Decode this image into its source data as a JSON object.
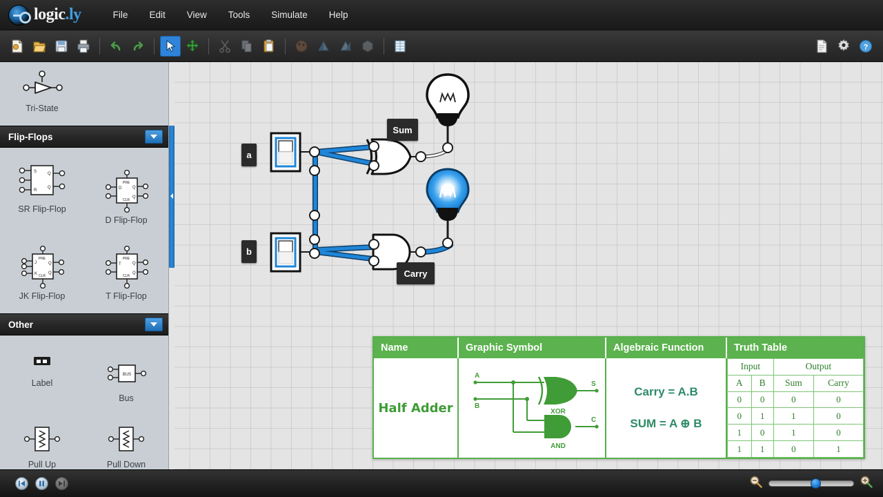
{
  "app": {
    "brand_name": "logic",
    "brand_suffix": ".ly",
    "brand_dot": "."
  },
  "menu": {
    "items": [
      {
        "label": "File",
        "name": "menu-file"
      },
      {
        "label": "Edit",
        "name": "menu-edit"
      },
      {
        "label": "View",
        "name": "menu-view"
      },
      {
        "label": "Tools",
        "name": "menu-tools"
      },
      {
        "label": "Simulate",
        "name": "menu-simulate"
      },
      {
        "label": "Help",
        "name": "menu-help"
      }
    ]
  },
  "toolbar": {
    "items": [
      {
        "icon": "new-document-icon",
        "label": "New"
      },
      {
        "icon": "open-folder-icon",
        "label": "Open"
      },
      {
        "icon": "save-disk-icon",
        "label": "Save"
      },
      {
        "icon": "print-icon",
        "label": "Print"
      },
      {
        "icon": "undo-arrow-icon",
        "label": "Undo"
      },
      {
        "icon": "redo-arrow-icon",
        "label": "Redo"
      },
      {
        "icon": "select-cursor-icon",
        "label": "Select"
      },
      {
        "icon": "move-pan-icon",
        "label": "Move"
      },
      {
        "icon": "cut-scissors-icon",
        "label": "Cut"
      },
      {
        "icon": "copy-icon",
        "label": "Copy"
      },
      {
        "icon": "paste-clipboard-icon",
        "label": "Paste"
      },
      {
        "icon": "color-palette-icon",
        "label": "Color"
      },
      {
        "icon": "bring-forward-icon",
        "label": "Bring Forward"
      },
      {
        "icon": "send-backward-icon",
        "label": "Send Backward"
      },
      {
        "icon": "group-icon",
        "label": "Group"
      },
      {
        "icon": "truth-table-icon",
        "label": "Truth Table"
      }
    ],
    "active_tool": "select-cursor-icon",
    "right_items": [
      {
        "icon": "properties-icon",
        "label": "Properties"
      },
      {
        "icon": "gear-icon",
        "label": "Settings"
      },
      {
        "icon": "help-icon",
        "label": "Help"
      }
    ]
  },
  "sidebar": {
    "top_section": {
      "items": [
        {
          "label": "Tri-State",
          "icon": "tri-state-buffer-icon"
        }
      ]
    },
    "sections": [
      {
        "title": "Flip-Flops",
        "name": "section-flip-flops",
        "items": [
          {
            "label": "SR Flip-Flop",
            "icon": "sr-flip-flop-icon"
          },
          {
            "label": "D Flip-Flop",
            "icon": "d-flip-flop-icon"
          },
          {
            "label": "JK Flip-Flop",
            "icon": "jk-flip-flop-icon"
          },
          {
            "label": "T Flip-Flop",
            "icon": "t-flip-flop-icon"
          }
        ]
      },
      {
        "title": "Other",
        "name": "section-other",
        "items": [
          {
            "label": "Label",
            "icon": "label-icon"
          },
          {
            "label": "Bus",
            "icon": "bus-icon"
          },
          {
            "label": "Pull Up",
            "icon": "pull-up-resistor-icon"
          },
          {
            "label": "Pull Down",
            "icon": "pull-down-resistor-icon"
          }
        ]
      }
    ]
  },
  "canvas": {
    "labels": {
      "input_a": "a",
      "input_b": "b",
      "output_sum": "Sum",
      "output_carry": "Carry"
    },
    "components": {
      "switch_a_state": "on",
      "switch_b_state": "on",
      "xor_gate": "XOR",
      "and_gate": "AND",
      "sum_bulb_state": "off",
      "carry_bulb_state": "on"
    },
    "colors": {
      "wire_high": "#1f7fd0",
      "wire_low": "#ffffff",
      "grid": "#e4e4e4",
      "bulb_lit": "#2196f3"
    }
  },
  "reference_card": {
    "headers": [
      "Name",
      "Graphic Symbol",
      "Algebraic Function",
      "Truth Table"
    ],
    "name": "Half Adder",
    "symbol": {
      "inputs": [
        "A",
        "B"
      ],
      "outputs": [
        "S",
        "C"
      ],
      "gates": [
        "XOR",
        "AND"
      ]
    },
    "algebraic": [
      "Carry = A.B",
      "SUM = A ⊕ B"
    ],
    "truth_table": {
      "group_headers": [
        "Input",
        "Output"
      ],
      "columns": [
        "A",
        "B",
        "Sum",
        "Carry"
      ],
      "rows": [
        [
          "0",
          "0",
          "0",
          "0"
        ],
        [
          "0",
          "1",
          "1",
          "0"
        ],
        [
          "1",
          "0",
          "1",
          "0"
        ],
        [
          "1",
          "1",
          "0",
          "1"
        ]
      ]
    },
    "accent_color": "#5cb24e"
  },
  "statusbar": {
    "sim_buttons": [
      {
        "icon": "restart-simulation-icon",
        "label": "Restart",
        "enabled": true
      },
      {
        "icon": "pause-simulation-icon",
        "label": "Pause",
        "enabled": true
      },
      {
        "icon": "step-simulation-icon",
        "label": "Step",
        "enabled": false
      }
    ],
    "zoom": {
      "out_icon": "zoom-out-icon",
      "in_icon": "zoom-in-icon",
      "value_percent": 55
    }
  },
  "chart_data": {
    "type": "table",
    "title": "Half Adder Truth Table",
    "categories": [
      "A",
      "B",
      "Sum",
      "Carry"
    ],
    "rows": [
      [
        0,
        0,
        0,
        0
      ],
      [
        0,
        1,
        1,
        0
      ],
      [
        1,
        0,
        1,
        0
      ],
      [
        1,
        1,
        0,
        1
      ]
    ]
  }
}
